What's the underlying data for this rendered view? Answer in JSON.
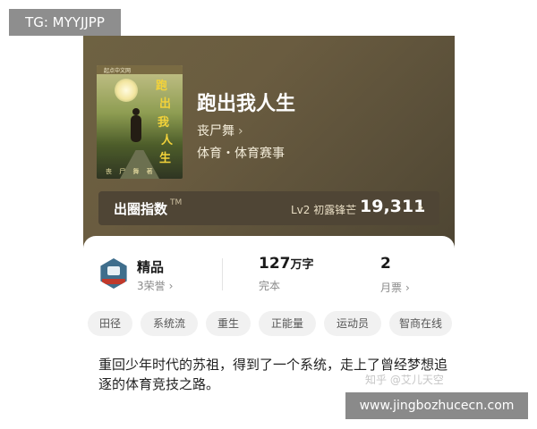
{
  "watermarks": {
    "telegram": "TG: MYYJJPP",
    "zhihu": "知乎 @艾儿天空",
    "site": "www.jingbozhucecn.com"
  },
  "cover": {
    "publisher": "起点中文网",
    "title_chars": [
      "跑",
      "出",
      "我",
      "人",
      "生"
    ],
    "author": "丧 尸 舞 著"
  },
  "book": {
    "title": "跑出我人生",
    "author": "丧尸舞",
    "genre": "体育・体育赛事"
  },
  "popularity": {
    "label": "出圈指数",
    "tm": "TM",
    "level": "Lv2 初露锋芒",
    "value": "19,311"
  },
  "stats": {
    "quality": {
      "title": "精品",
      "sub": "3荣誉"
    },
    "words": {
      "number": "127",
      "unit": "万字",
      "sub": "完本"
    },
    "tickets": {
      "number": "2",
      "sub": "月票"
    }
  },
  "tags": [
    "田径",
    "系统流",
    "重生",
    "正能量",
    "运动员",
    "智商在线"
  ],
  "description": "重回少年时代的苏祖，得到了一个系统，走上了曾经梦想追逐的体育竞技之路。",
  "icons": {
    "chevron": "›"
  },
  "colors": {
    "hero_bg": "#6a5c40",
    "popularity_bar": "#4f4535",
    "tag_bg": "#f1f1f1",
    "badge": "#3f6e8c"
  }
}
